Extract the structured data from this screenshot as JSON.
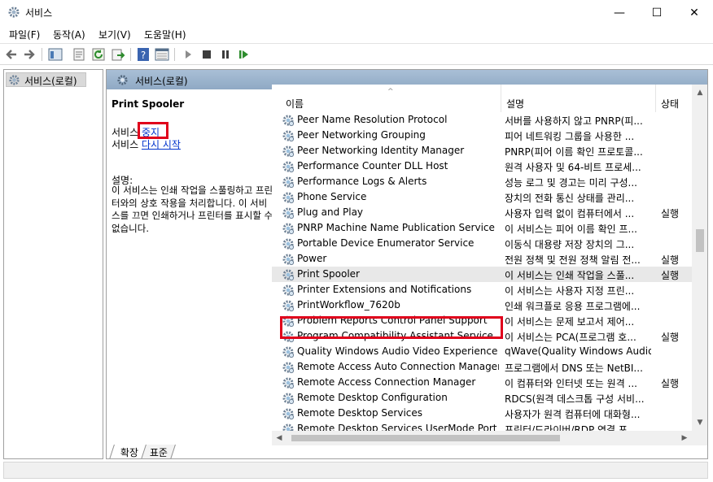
{
  "window": {
    "title": "서비스",
    "min_glyph": "—",
    "max_glyph": "☐",
    "close_glyph": "✕"
  },
  "menu": [
    "파일(F)",
    "동작(A)",
    "보기(V)",
    "도움말(H)"
  ],
  "toolbar_icons": [
    "back-icon",
    "forward-icon",
    "show-tree-icon",
    "properties-icon",
    "refresh-icon",
    "export-icon",
    "help-icon",
    "view-icon",
    "start-icon",
    "stop-icon",
    "pause-icon",
    "restart-icon"
  ],
  "tree": {
    "root_label": "서비스(로컬)"
  },
  "pane": {
    "header": "서비스(로컬)"
  },
  "detail": {
    "service_name": "Print Spooler",
    "action_prefix": "서비스 ",
    "stop_link": "중지",
    "restart_link": "다시 시작",
    "desc_label": "설명:",
    "desc_text": "이 서비스는 인쇄 작업을 스풀링하고 프린터와의 상호 작용을 처리합니다. 이 서비스를 끄면 인쇄하거나 프린터를 표시할 수 없습니다."
  },
  "columns": {
    "name": "이름",
    "desc": "설명",
    "status": "상태",
    "sort_glyph": "^"
  },
  "rows": [
    {
      "name": "Peer Name Resolution Protocol",
      "desc": "서버를 사용하지 않고 PNRP(피...",
      "status": ""
    },
    {
      "name": "Peer Networking Grouping",
      "desc": "피어 네트워킹 그룹을 사용한 ...",
      "status": ""
    },
    {
      "name": "Peer Networking Identity Manager",
      "desc": "PNRP(피어 이름 확인 프로토콜...",
      "status": ""
    },
    {
      "name": "Performance Counter DLL Host",
      "desc": "원격 사용자 및 64-비트 프로세...",
      "status": ""
    },
    {
      "name": "Performance Logs & Alerts",
      "desc": "성능 로그 및 경고는 미리 구성...",
      "status": ""
    },
    {
      "name": "Phone Service",
      "desc": "장치의 전화 통신 상태를 관리...",
      "status": ""
    },
    {
      "name": "Plug and Play",
      "desc": "사용자 입력 없이 컴퓨터에서 ...",
      "status": "실행"
    },
    {
      "name": "PNRP Machine Name Publication Service",
      "desc": "이 서비스는 피어 이름 확인 프...",
      "status": ""
    },
    {
      "name": "Portable Device Enumerator Service",
      "desc": "이동식 대용량 저장 장치의 그...",
      "status": ""
    },
    {
      "name": "Power",
      "desc": "전원 정책 및 전원 정책 알림 전...",
      "status": "실행"
    },
    {
      "name": "Print Spooler",
      "desc": "이 서비스는 인쇄 작업을 스풀...",
      "status": "실행",
      "selected": true
    },
    {
      "name": "Printer Extensions and Notifications",
      "desc": "이 서비스는 사용자 지정 프린...",
      "status": ""
    },
    {
      "name": "PrintWorkflow_7620b",
      "desc": "인쇄 워크플로 응용 프로그램에...",
      "status": ""
    },
    {
      "name": "Problem Reports Control Panel Support",
      "desc": "이 서비스는 문제 보고서 제어...",
      "status": ""
    },
    {
      "name": "Program Compatibility Assistant Service",
      "desc": "이 서비스는 PCA(프로그램 호...",
      "status": "실행"
    },
    {
      "name": "Quality Windows Audio Video Experience",
      "desc": "qWave(Quality Windows Audio...",
      "status": ""
    },
    {
      "name": "Remote Access Auto Connection Manager",
      "desc": "프로그램에서 DNS 또는 NetBI...",
      "status": ""
    },
    {
      "name": "Remote Access Connection Manager",
      "desc": "이 컴퓨터와 인터넷 또는 원격 ...",
      "status": "실행"
    },
    {
      "name": "Remote Desktop Configuration",
      "desc": "RDCS(원격 데스크톱 구성 서비...",
      "status": ""
    },
    {
      "name": "Remote Desktop Services",
      "desc": "사용자가 원격 컴퓨터에 대화형...",
      "status": ""
    },
    {
      "name": "Remote Desktop Services UserMode Port Re...",
      "desc": "프린터/드라이버/RDP 연결 포...",
      "status": ""
    }
  ],
  "scroll": {
    "up": "▲",
    "down": "▼",
    "left": "◀",
    "right": "▶",
    "v_position": 0.44
  },
  "tabs": [
    "확장",
    "표준"
  ],
  "colors": {
    "highlight": "#e0001b",
    "link": "#0033cc",
    "header": "#98b1cb"
  }
}
